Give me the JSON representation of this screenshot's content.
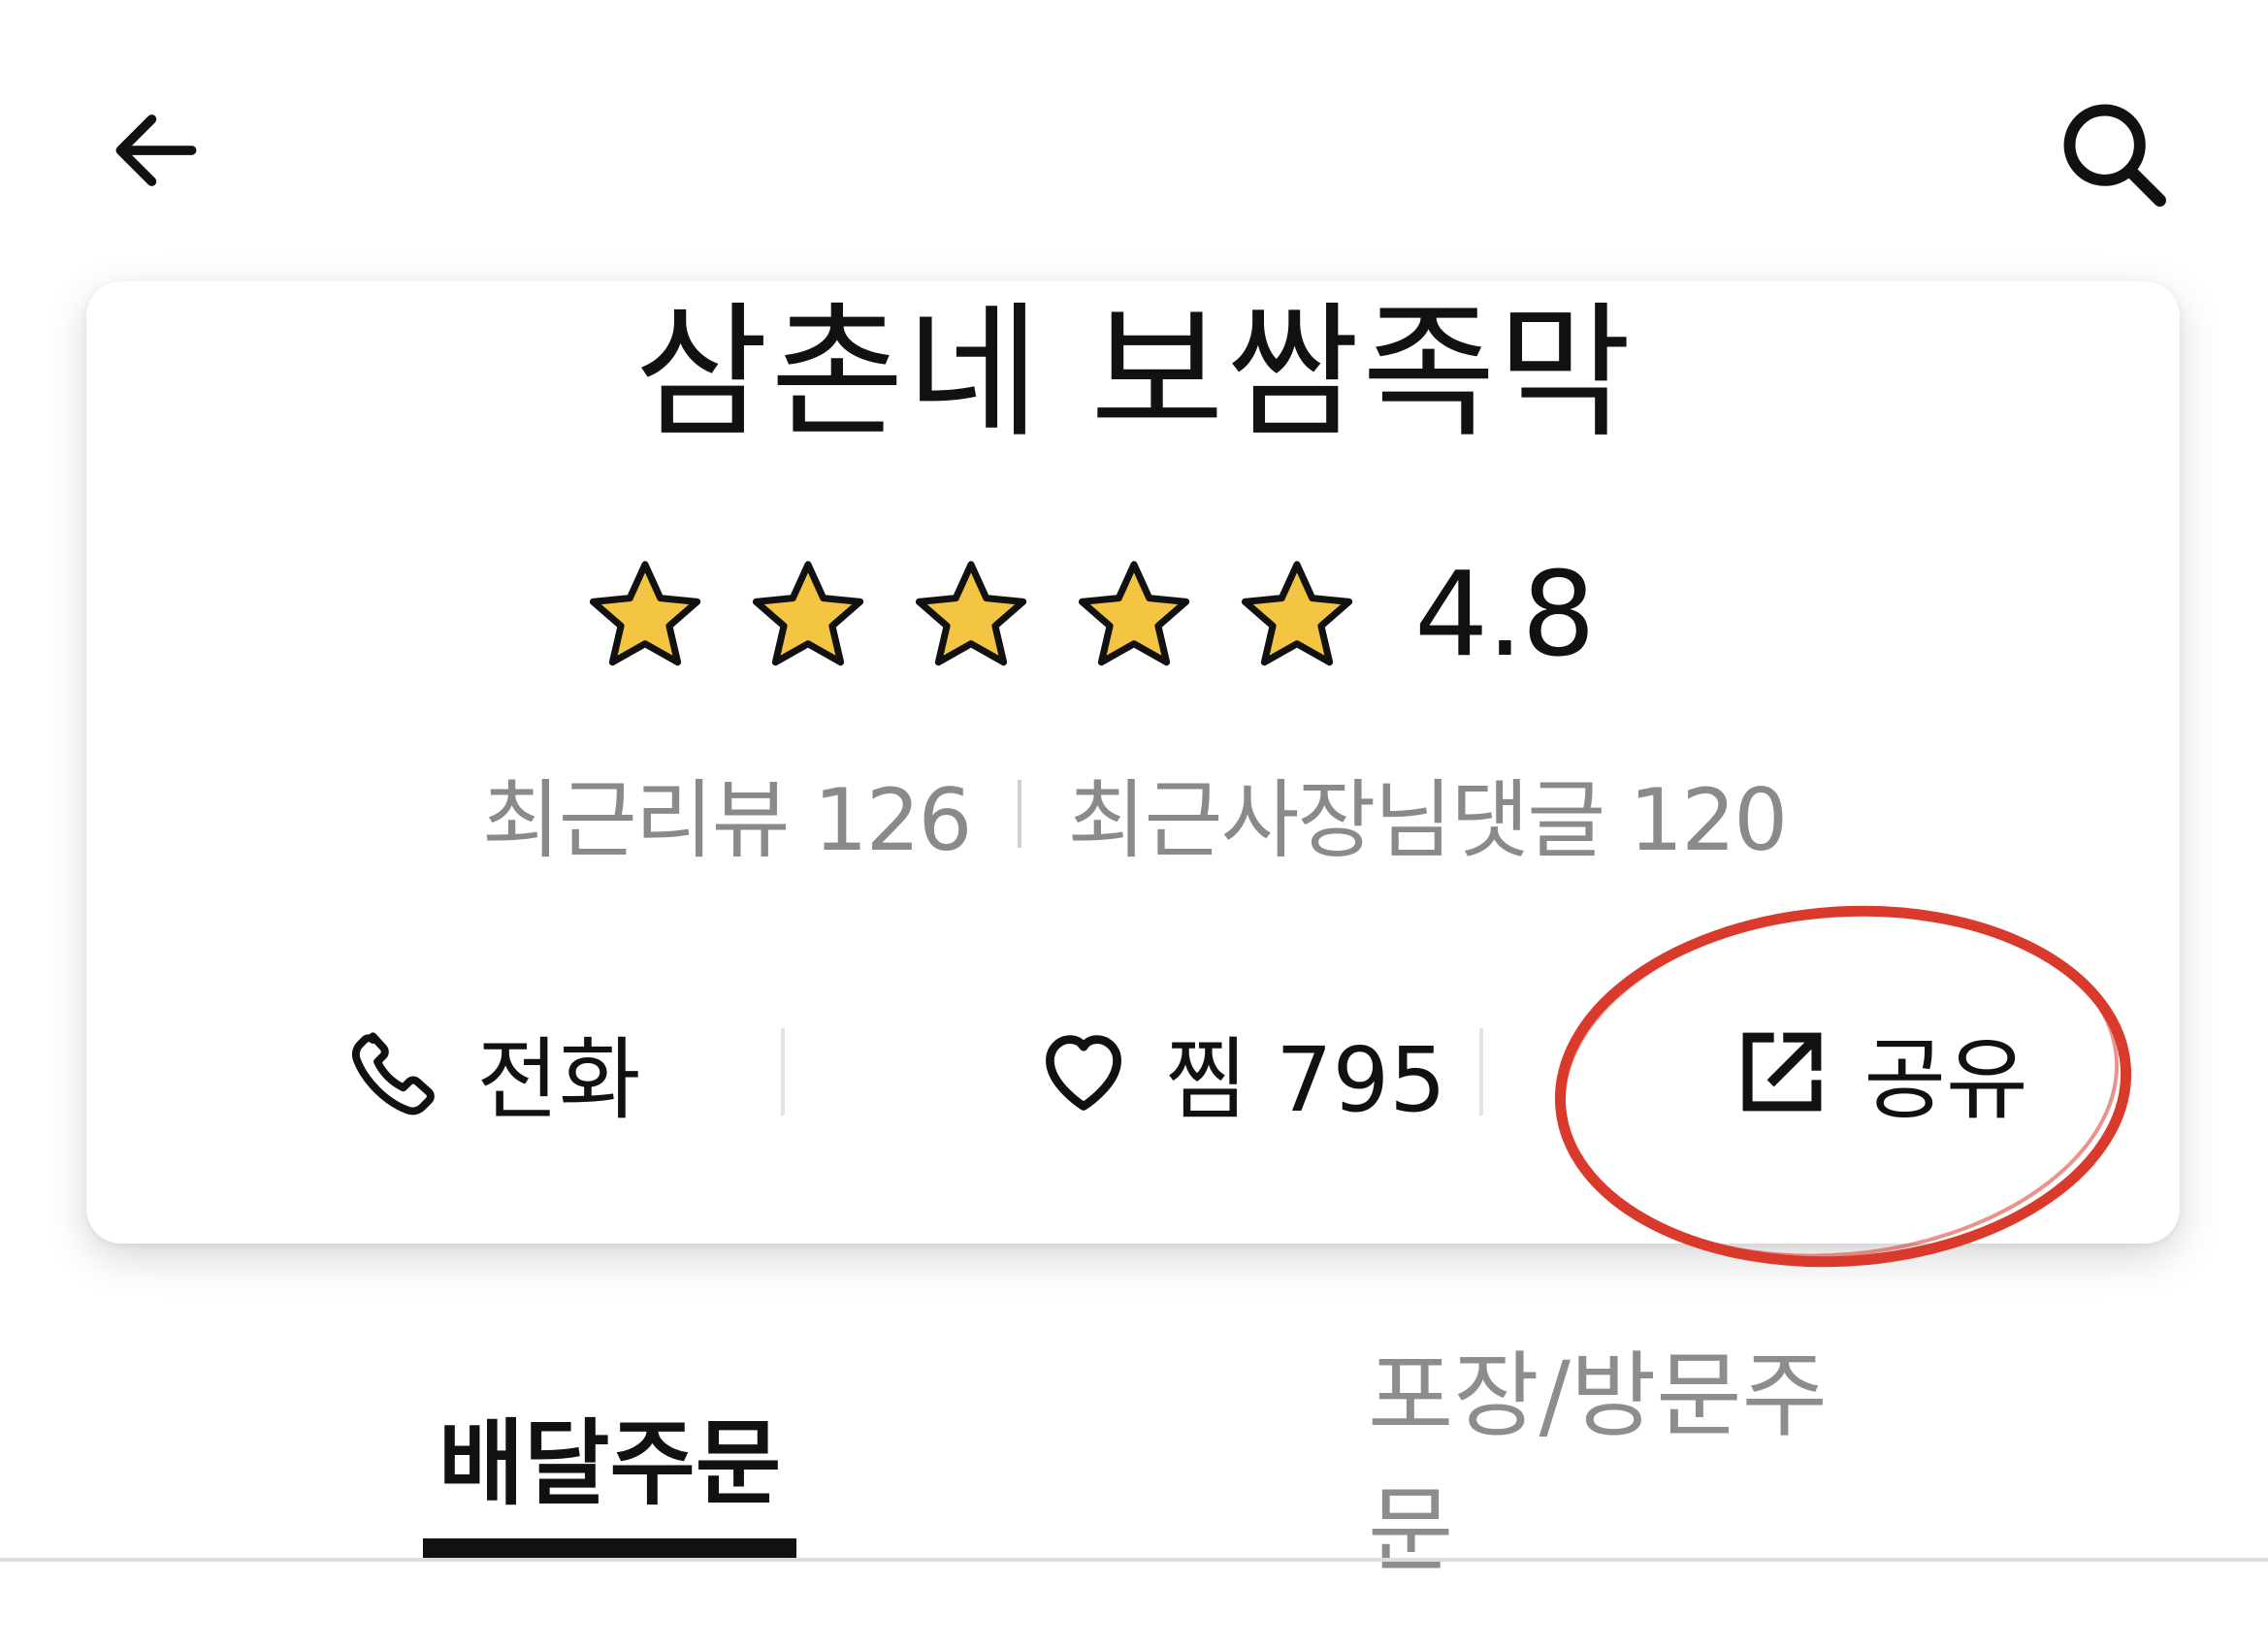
{
  "store": {
    "name": "삼촌네 보쌈족막",
    "rating": "4.8",
    "stars": 5,
    "reviews_label": "최근리뷰 126",
    "owner_replies_label": "최근사장님댓글 120"
  },
  "actions": {
    "call_label": "전화",
    "like_label": "찜 795",
    "share_label": "공유"
  },
  "tabs": [
    {
      "label": "배달주문",
      "active": true
    },
    {
      "label": "포장/방문주문",
      "active": false
    }
  ],
  "icons": {
    "back": "back-arrow-icon",
    "search": "search-icon",
    "star": "star-icon",
    "call": "phone-icon",
    "like": "heart-icon",
    "share": "share-icon"
  },
  "colors": {
    "star_fill": "#F4C542",
    "annotation": "#D93A2B",
    "active_tab": "#111111",
    "inactive_tab": "#8D8D8D",
    "muted_text": "#8A8A8A"
  }
}
